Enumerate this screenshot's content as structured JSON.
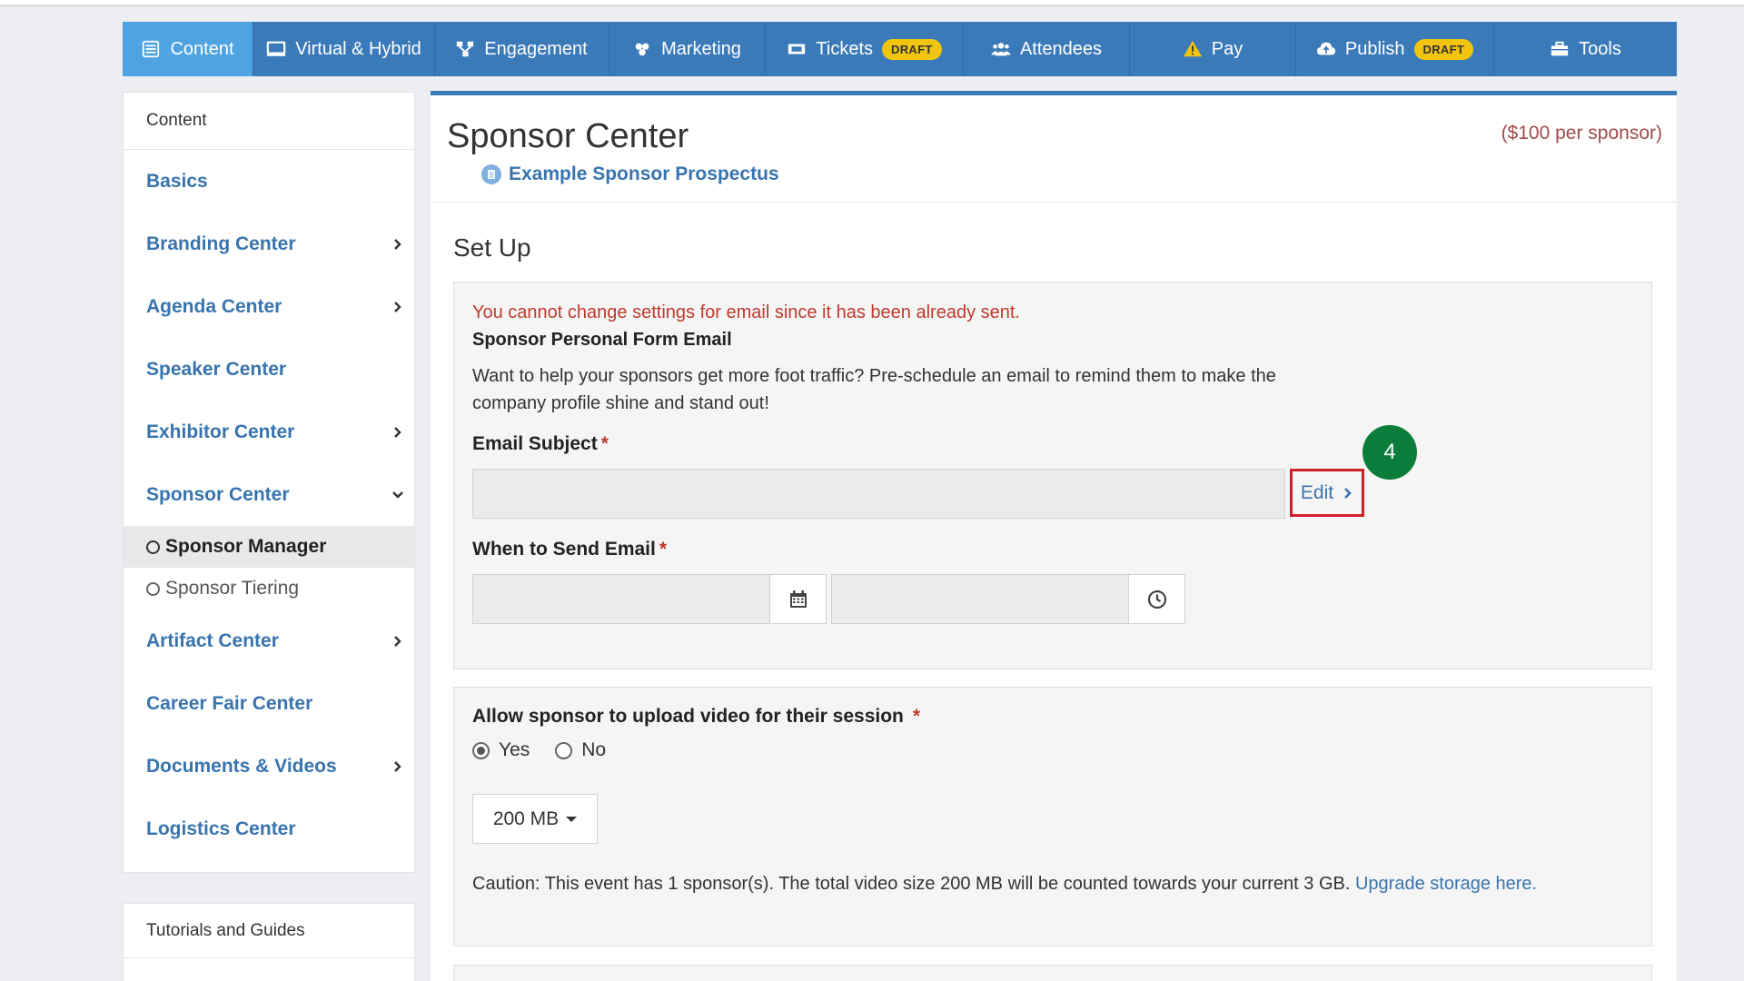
{
  "nav": {
    "items": [
      {
        "label": "Content",
        "icon": "list-icon",
        "active": true
      },
      {
        "label": "Virtual & Hybrid",
        "icon": "monitor-icon"
      },
      {
        "label": "Engagement",
        "icon": "network-icon"
      },
      {
        "label": "Marketing",
        "icon": "marketing-icon"
      },
      {
        "label": "Tickets",
        "icon": "ticket-icon",
        "badge": "DRAFT"
      },
      {
        "label": "Attendees",
        "icon": "users-icon"
      },
      {
        "label": "Pay",
        "icon": "warning-icon"
      },
      {
        "label": "Publish",
        "icon": "cloud-upload-icon",
        "badge": "DRAFT"
      },
      {
        "label": "Tools",
        "icon": "toolbox-icon"
      }
    ]
  },
  "sidebar": {
    "header": "Content",
    "items": [
      {
        "label": "Basics"
      },
      {
        "label": "Branding Center"
      },
      {
        "label": "Agenda Center"
      },
      {
        "label": "Speaker Center"
      },
      {
        "label": "Exhibitor Center"
      },
      {
        "label": "Sponsor Center"
      },
      {
        "label": "Sponsor Manager"
      },
      {
        "label": "Sponsor Tiering"
      },
      {
        "label": "Artifact Center"
      },
      {
        "label": "Career Fair Center"
      },
      {
        "label": "Documents & Videos"
      },
      {
        "label": "Logistics Center"
      }
    ],
    "footer_header": "Tutorials and Guides"
  },
  "main": {
    "title": "Sponsor Center",
    "price": "($100 per sponsor)",
    "prospectus_link": "Example Sponsor Prospectus",
    "section_title": "Set Up",
    "email_panel": {
      "warning": "You cannot change settings for email since it has been already sent.",
      "form_title": "Sponsor Personal Form Email",
      "description": "Want to help your sponsors get more foot traffic? Pre-schedule an email to remind them to make the company profile shine and stand out!",
      "subject_label": "Email Subject",
      "subject_value": "",
      "edit_label": "Edit",
      "step_number": "4",
      "send_label": "When to Send Email",
      "date_value": "",
      "time_value": "",
      "required_mark": "*"
    },
    "video_panel": {
      "label": "Allow sponsor to upload video for their session",
      "yes_label": "Yes",
      "no_label": "No",
      "selected": "Yes",
      "size_value": "200 MB",
      "caution_text": "Caution: This event has 1 sponsor(s). The total video size 200 MB will be counted towards your current 3 GB.",
      "upgrade_link": "Upgrade storage here."
    }
  },
  "colors": {
    "nav_bg": "#3b7ab9",
    "nav_active": "#4ea3e0",
    "link": "#3874ae",
    "warning": "#c0392b",
    "badge": "#f1c40f",
    "step_badge": "#0a7d3b",
    "highlight_border": "#d0212a"
  }
}
